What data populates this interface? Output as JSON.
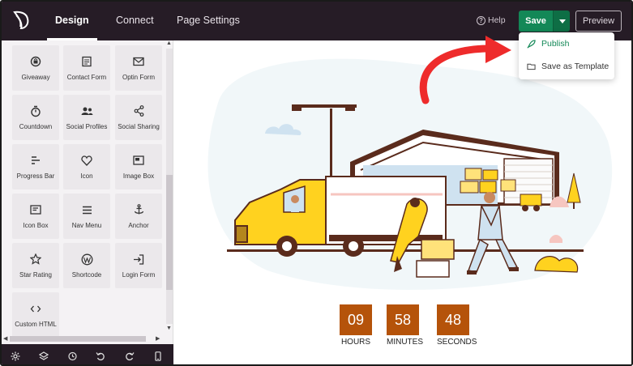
{
  "header": {
    "tabs": [
      {
        "label": "Design"
      },
      {
        "label": "Connect"
      },
      {
        "label": "Page Settings"
      }
    ],
    "help_label": "Help",
    "save_label": "Save",
    "preview_label": "Preview"
  },
  "save_menu": {
    "items": [
      {
        "label": "Publish",
        "icon": "rocket-icon"
      },
      {
        "label": "Save as Template",
        "icon": "folder-icon"
      }
    ]
  },
  "sidebar": {
    "blocks": [
      {
        "label": "Giveaway",
        "icon": "gift-badge-icon"
      },
      {
        "label": "Contact Form",
        "icon": "form-icon"
      },
      {
        "label": "Optin Form",
        "icon": "envelope-icon"
      },
      {
        "label": "Countdown",
        "icon": "stopwatch-icon"
      },
      {
        "label": "Social Profiles",
        "icon": "users-icon"
      },
      {
        "label": "Social Sharing",
        "icon": "share-icon"
      },
      {
        "label": "Progress Bar",
        "icon": "bars-icon"
      },
      {
        "label": "Icon",
        "icon": "heart-icon"
      },
      {
        "label": "Image Box",
        "icon": "image-box-icon"
      },
      {
        "label": "Icon Box",
        "icon": "icon-box-icon"
      },
      {
        "label": "Nav Menu",
        "icon": "menu-icon"
      },
      {
        "label": "Anchor",
        "icon": "anchor-icon"
      },
      {
        "label": "Star Rating",
        "icon": "star-icon"
      },
      {
        "label": "Shortcode",
        "icon": "wordpress-icon"
      },
      {
        "label": "Login Form",
        "icon": "login-icon"
      },
      {
        "label": "Custom HTML",
        "icon": "code-icon"
      }
    ],
    "toolbar_icons": [
      "settings-icon",
      "layers-icon",
      "history-icon",
      "undo-icon",
      "redo-icon",
      "mobile-preview-icon"
    ]
  },
  "countdown": [
    {
      "value": "09",
      "label": "HOURS"
    },
    {
      "value": "58",
      "label": "MINUTES"
    },
    {
      "value": "48",
      "label": "SECONDS"
    }
  ],
  "colors": {
    "topbar": "#261c26",
    "save_green": "#138857",
    "countdown_box": "#b5530a",
    "annotation_arrow": "#ee2b2b",
    "truck_yellow": "#ffd21f"
  }
}
